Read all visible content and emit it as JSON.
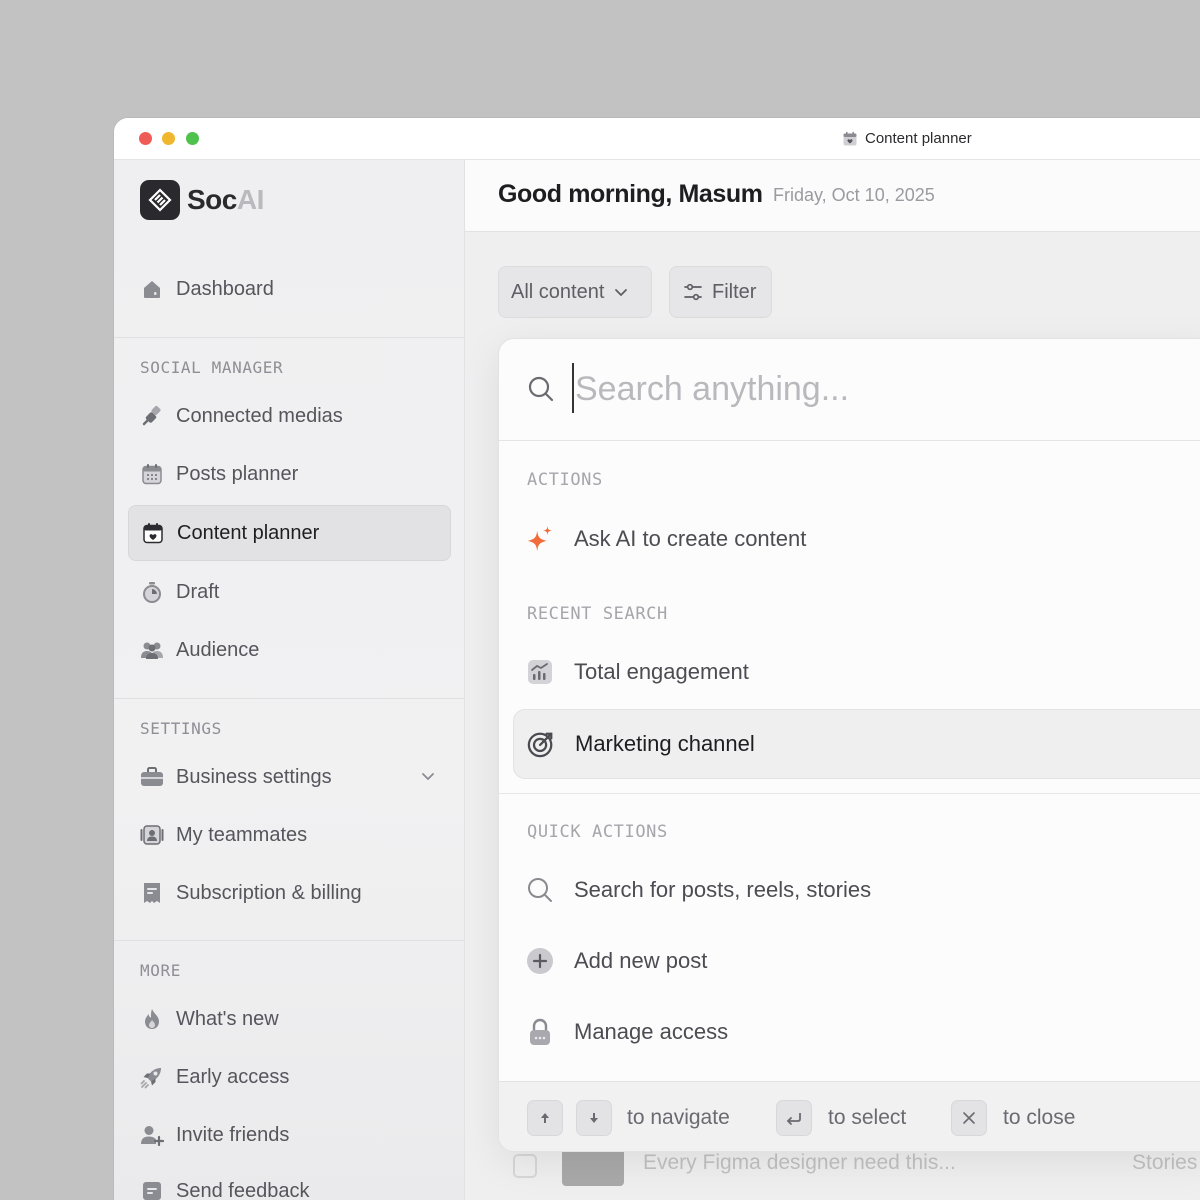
{
  "window": {
    "title": "Content planner"
  },
  "brand": {
    "name_part1": "Soc",
    "name_part2": "AI"
  },
  "sidebar": {
    "dashboard": "Dashboard",
    "sections": {
      "social_manager": "SOCIAL MANAGER",
      "settings": "SETTINGS",
      "more": "MORE"
    },
    "social_items": [
      {
        "label": "Connected medias",
        "icon": "plug-icon"
      },
      {
        "label": "Posts planner",
        "icon": "calendar-icon"
      },
      {
        "label": "Content planner",
        "icon": "calendar-heart-icon",
        "active": true
      },
      {
        "label": "Draft",
        "icon": "timer-icon"
      },
      {
        "label": "Audience",
        "icon": "users-icon"
      }
    ],
    "settings_items": [
      {
        "label": "Business settings",
        "icon": "briefcase-icon"
      },
      {
        "label": "My teammates",
        "icon": "team-icon"
      },
      {
        "label": "Subscription & billing",
        "icon": "receipt-icon"
      }
    ],
    "more_items": [
      {
        "label": "What's new",
        "icon": "flame-icon"
      },
      {
        "label": "Early access",
        "icon": "rocket-icon"
      },
      {
        "label": "Invite friends",
        "icon": "user-plus-icon"
      },
      {
        "label": "Send feedback",
        "icon": "feedback-icon"
      }
    ]
  },
  "header": {
    "greeting": "Good morning, Masum",
    "date": "Friday, Oct 10, 2025"
  },
  "toolbar": {
    "content_dropdown": "All content",
    "filter": "Filter"
  },
  "background_row": {
    "title": "Every Figma designer need this...",
    "type": "Stories"
  },
  "palette": {
    "search_placeholder": "Search anything...",
    "actions_label": "ACTIONS",
    "ask_ai": "Ask AI to create content",
    "recent_label": "RECENT SEARCH",
    "recent": [
      "Total engagement",
      "Marketing channel"
    ],
    "quick_label": "QUICK ACTIONS",
    "quick": [
      "Search for posts, reels, stories",
      "Add new post",
      "Manage access"
    ],
    "footer": {
      "navigate": "to navigate",
      "select": "to select",
      "close": "to close"
    }
  },
  "colors": {
    "accent_orange": "#f26b3a",
    "sidebar_bg": "#efeff1",
    "active_bg": "#e2e2e5"
  }
}
